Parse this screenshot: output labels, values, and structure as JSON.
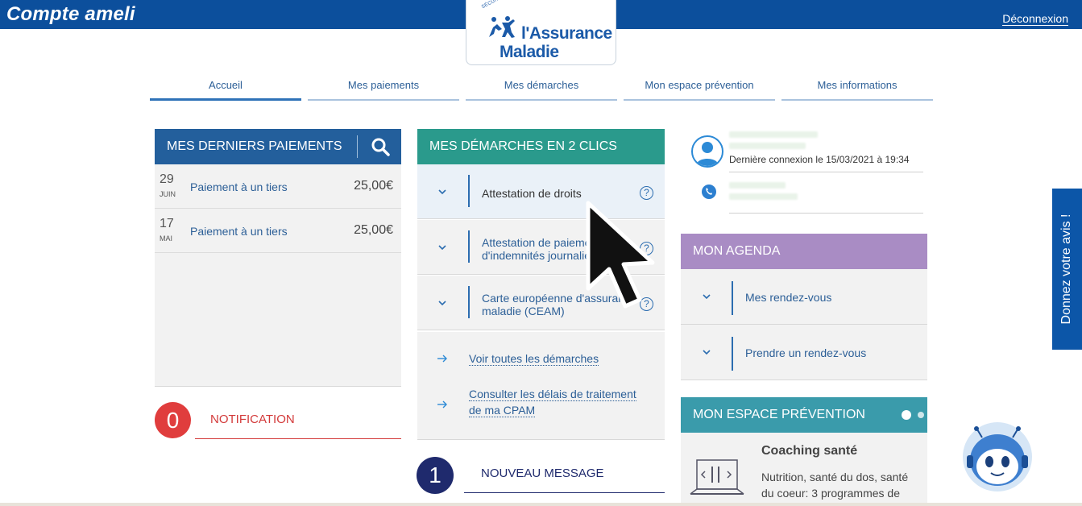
{
  "header": {
    "app_title": "Compte ameli",
    "logout_label": "Déconnexion",
    "logo": {
      "small_text": "SÉCURITÉ SOCIALE",
      "line1": "l'Assurance",
      "line2": "Maladie"
    }
  },
  "nav": {
    "tabs": [
      {
        "label": "Accueil",
        "active": true
      },
      {
        "label": "Mes paiements",
        "active": false
      },
      {
        "label": "Mes démarches",
        "active": false
      },
      {
        "label": "Mon espace prévention",
        "active": false
      },
      {
        "label": "Mes informations",
        "active": false
      }
    ]
  },
  "payments": {
    "title": "MES DERNIERS PAIEMENTS",
    "rows": [
      {
        "day": "29",
        "month": "JUIN",
        "label": "Paiement à un tiers",
        "amount": "25,00€"
      },
      {
        "day": "17",
        "month": "MAI",
        "label": "Paiement à un tiers",
        "amount": "25,00€"
      }
    ]
  },
  "notification": {
    "count": "0",
    "label": "NOTIFICATION"
  },
  "demarches": {
    "title": "MES DÉMARCHES EN 2 CLICS",
    "items": [
      {
        "line1": "Attestation de droits",
        "line2": ""
      },
      {
        "line1": "Attestation de paiement",
        "line2": "d'indemnités journalières"
      },
      {
        "line1": "Carte européenne d'assurance",
        "line2": "maladie (CEAM)"
      }
    ],
    "help_glyph": "?",
    "links": [
      {
        "line1": "Voir toutes les démarches",
        "line2": ""
      },
      {
        "line1": "Consulter les délais de traitement",
        "line2": "de ma CPAM"
      }
    ]
  },
  "messages": {
    "count": "1",
    "label": "NOUVEAU MESSAGE"
  },
  "profile": {
    "last_connection": "Dernière connexion le 15/03/2021 à 19:34"
  },
  "agenda": {
    "title": "MON AGENDA",
    "items": [
      "Mes rendez-vous",
      "Prendre un rendez-vous"
    ]
  },
  "prevention": {
    "title": "MON ESPACE PRÉVENTION",
    "card_title": "Coaching santé",
    "card_text": "Nutrition, santé du dos, santé du coeur: 3 programmes de"
  },
  "feedback": {
    "label": "Donnez votre avis !"
  },
  "colors": {
    "header_blue": "#0c4f9c",
    "payments_blue": "#235f9c",
    "demarches_teal": "#2a9a8c",
    "agenda_purple": "#a98cc4",
    "prevention_teal": "#3a9bab",
    "notification_red": "#e03d3d",
    "message_navy": "#1f2a6d"
  },
  "icons": [
    "search-icon",
    "chevron-down-icon",
    "help-icon",
    "arrow-right-icon",
    "user-icon",
    "phone-icon",
    "chatbot-icon",
    "cursor-icon"
  ]
}
